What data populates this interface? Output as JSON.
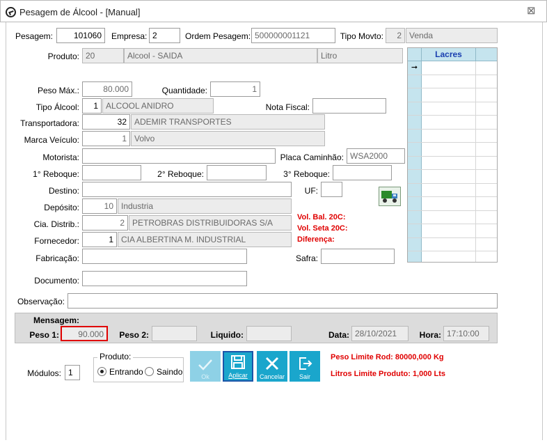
{
  "window": {
    "title": "Pesagem de Álcool - [Manual]",
    "close": "⊠"
  },
  "form": {
    "pesagem": {
      "label": "Pesagem:",
      "value": "101060"
    },
    "empresa": {
      "label": "Empresa:",
      "value": "2"
    },
    "ordem_pesagem": {
      "label": "Ordem Pesagem:",
      "value": "500000001121"
    },
    "tipo_movto": {
      "label": "Tipo Movto:",
      "code": "2",
      "desc": "Venda"
    },
    "produto": {
      "label": "Produto:",
      "code": "20",
      "desc": "Alcool - SAIDA",
      "unit": "Litro"
    },
    "peso_max": {
      "label": "Peso Máx.:",
      "value": "80.000"
    },
    "quantidade": {
      "label": "Quantidade:",
      "value": "1"
    },
    "tipo_alcool": {
      "label": "Tipo Álcool:",
      "code": "1",
      "desc": "ALCOOL ANIDRO"
    },
    "nota_fiscal": {
      "label": "Nota Fiscal:",
      "value": ""
    },
    "transportadora": {
      "label": "Transportadora:",
      "code": "32",
      "desc": "ADEMIR TRANSPORTES"
    },
    "marca_veiculo": {
      "label": "Marca Veículo:",
      "code": "1",
      "desc": "Volvo"
    },
    "motorista": {
      "label": "Motorista:",
      "value": ""
    },
    "placa_caminhao": {
      "label": "Placa Caminhão:",
      "value": "WSA2000"
    },
    "reboque1": {
      "label": "1° Reboque:",
      "value": ""
    },
    "reboque2": {
      "label": "2° Reboque:",
      "value": ""
    },
    "reboque3": {
      "label": "3° Reboque:",
      "value": ""
    },
    "destino": {
      "label": "Destino:",
      "value": ""
    },
    "uf": {
      "label": "UF:",
      "value": ""
    },
    "deposito": {
      "label": "Depósito:",
      "code": "10",
      "desc": "Industria"
    },
    "cia_distrib": {
      "label": "Cia. Distrib.:",
      "code": "2",
      "desc": "PETROBRAS DISTRIBUIDORAS S/A"
    },
    "fornecedor": {
      "label": "Fornecedor:",
      "code": "1",
      "desc": "CIA ALBERTINA M. INDUSTRIAL"
    },
    "fabricacao": {
      "label": "Fabricação:",
      "value": ""
    },
    "safra": {
      "label": "Safra:",
      "value": ""
    },
    "documento": {
      "label": "Documento:",
      "value": ""
    },
    "observacao": {
      "label": "Observação:",
      "value": ""
    },
    "vol_bal": "Vol. Bal. 20C:",
    "vol_seta": "Vol. Seta 20C:",
    "diferenca": "Diferença:"
  },
  "lacres": {
    "header": "Lacres",
    "row_count": 15
  },
  "panel": {
    "mensagem": "Mensagem:",
    "peso1": {
      "label": "Peso 1:",
      "value": "90.000"
    },
    "peso2": {
      "label": "Peso 2:",
      "value": ""
    },
    "liquido": {
      "label": "Liquido:",
      "value": ""
    },
    "data": {
      "label": "Data:",
      "value": "28/10/2021"
    },
    "hora": {
      "label": "Hora:",
      "value": "17:10:00"
    }
  },
  "bottom": {
    "modulos": {
      "label": "Módulos:",
      "value": "1"
    },
    "produto_group": "Produto:",
    "entrando": "Entrando",
    "saindo": "Saindo",
    "buttons": {
      "ok": "Ok",
      "aplicar": "Aplicar",
      "cancelar": "Cancelar",
      "sair": "Sair"
    },
    "peso_limite": "Peso Limite Rod: 80000,000 Kg",
    "litros_limite": "Litros Limite Produto: 1,000 Lts"
  },
  "colors": {
    "accent": "#1aa6cc",
    "warning": "#e00000",
    "header": "#c5e4ee"
  }
}
